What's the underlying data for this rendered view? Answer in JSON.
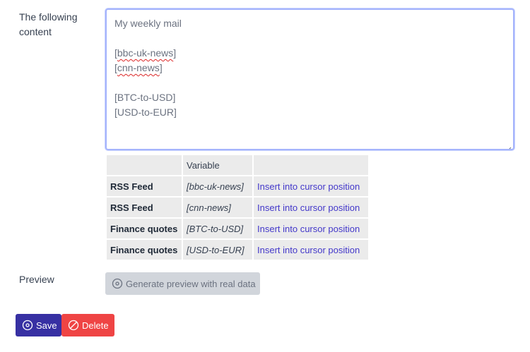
{
  "form": {
    "content_label": "The following content",
    "content_value": {
      "line1": "My weekly mail",
      "line2": "",
      "line3_open": "[",
      "line3_word": "bbc-uk-news",
      "line3_close": "]",
      "line4_open": "[",
      "line4_word": "cnn-news",
      "line4_close": "]",
      "line5": "",
      "line6": "[BTC-to-USD]",
      "line7": "[USD-to-EUR]"
    },
    "variables_table": {
      "headers": [
        "",
        "Variable",
        ""
      ],
      "rows": [
        {
          "type": "RSS Feed",
          "variable": "[bbc-uk-news]",
          "action": "Insert into cursor position"
        },
        {
          "type": "RSS Feed",
          "variable": "[cnn-news]",
          "action": "Insert into cursor position"
        },
        {
          "type": "Finance quotes",
          "variable": "[BTC-to-USD]",
          "action": "Insert into cursor position"
        },
        {
          "type": "Finance quotes",
          "variable": "[USD-to-EUR]",
          "action": "Insert into cursor position"
        }
      ]
    },
    "preview_label": "Preview",
    "preview_button_label": "Generate preview with real data",
    "save_label": "Save",
    "delete_label": "Delete"
  },
  "icons": {
    "preview": "circle-dot-icon",
    "save": "circle-dot-icon",
    "delete": "ban-icon"
  },
  "colors": {
    "accent": "#3730a3",
    "danger": "#ef4444",
    "link": "#4338ca",
    "focus_border": "#a5b4fc",
    "disabled_button": "#d1d5db"
  }
}
